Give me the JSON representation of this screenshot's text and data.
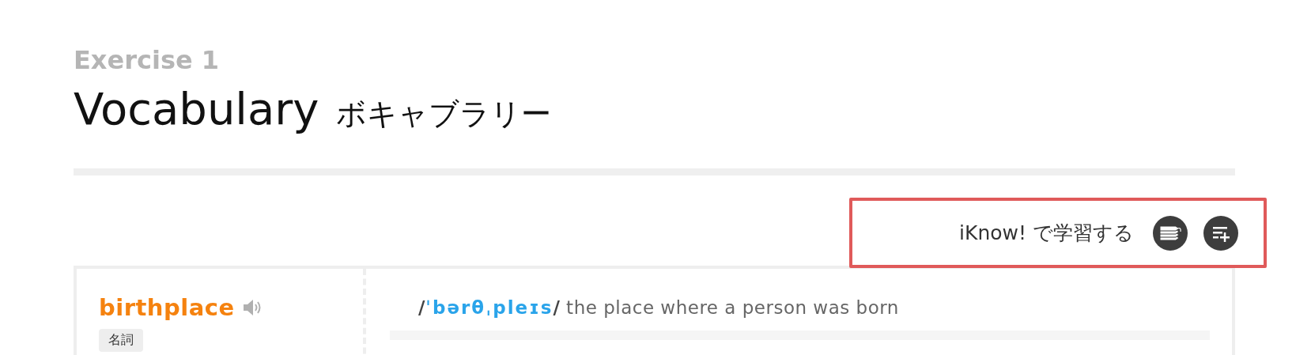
{
  "header": {
    "exercise": "Exercise 1",
    "title": "Vocabulary",
    "title_ja": "ボキャブラリー"
  },
  "study": {
    "label": "iKnow! で学習する"
  },
  "entry": {
    "word": "birthplace",
    "part_of_speech": "名詞",
    "slash_open": "/",
    "ipa": "ˈbərθˌpleɪs",
    "slash_close": "/",
    "definition": "the place where a person was born"
  }
}
